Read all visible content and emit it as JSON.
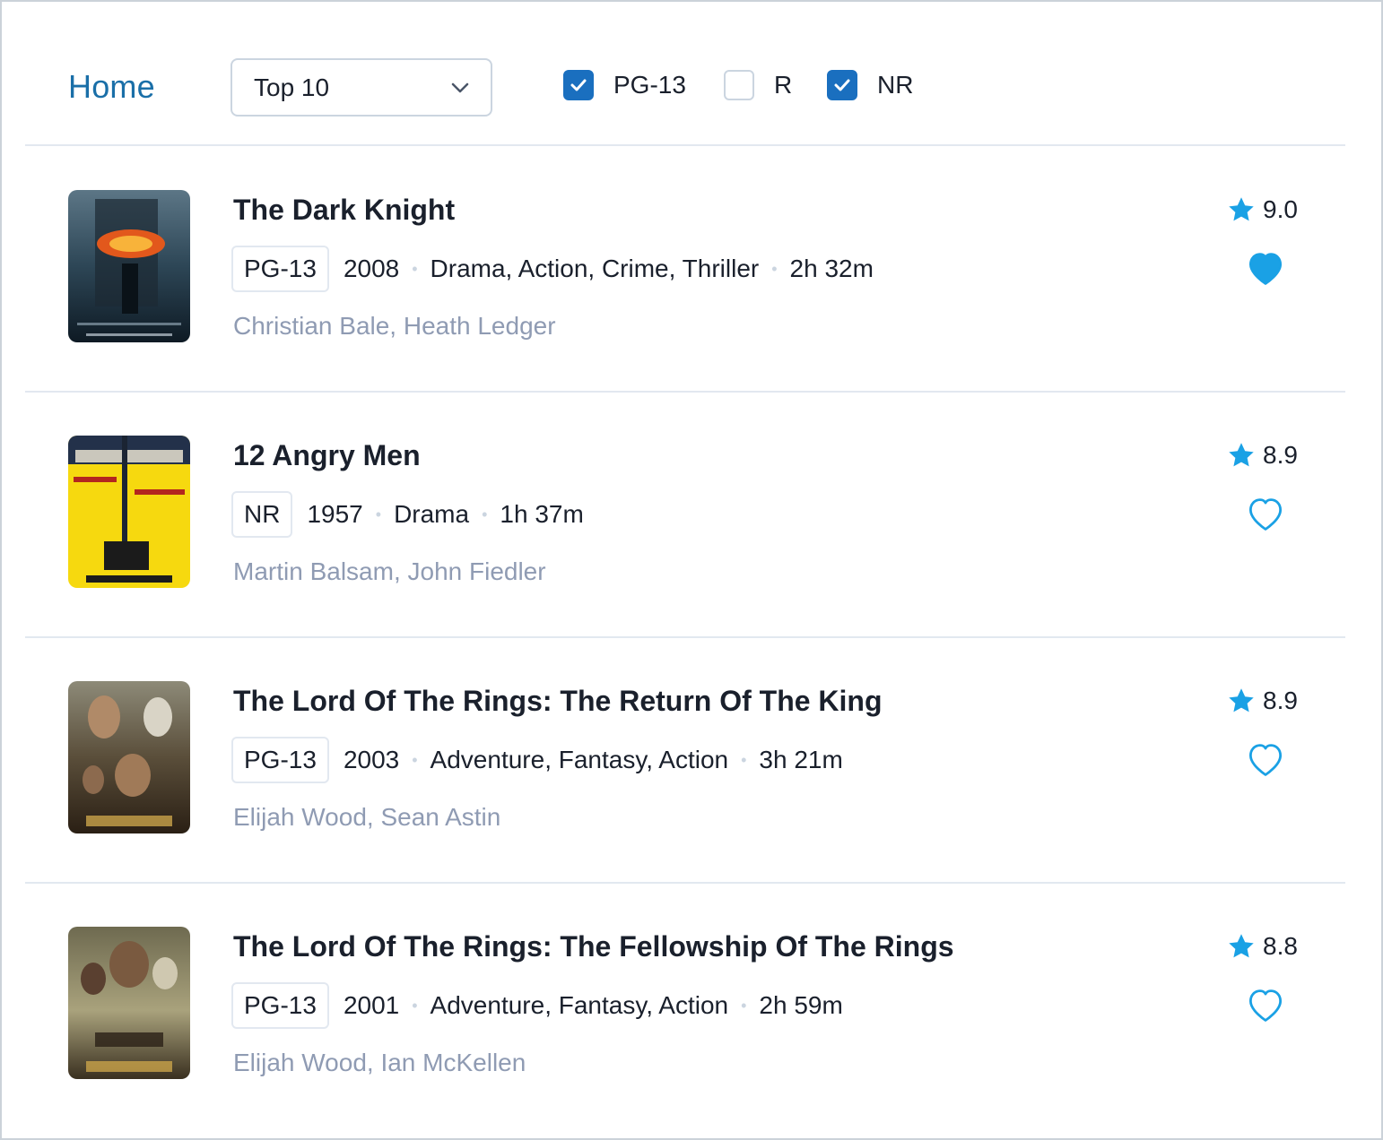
{
  "header": {
    "home_label": "Home",
    "list_select": {
      "value": "Top 10"
    },
    "filters": [
      {
        "label": "PG-13",
        "checked": true
      },
      {
        "label": "R",
        "checked": false
      },
      {
        "label": "NR",
        "checked": true
      }
    ]
  },
  "colors": {
    "accent": "#1aa1e5",
    "link": "#1a6fa8",
    "checkbox": "#1a6fbf",
    "muted": "#8f9bb3"
  },
  "movies": [
    {
      "title": "The Dark Knight",
      "rating": "PG-13",
      "year": "2008",
      "genres": "Drama, Action, Crime, Thriller",
      "runtime": "2h 32m",
      "cast": "Christian Bale, Heath Ledger",
      "score": "9.0",
      "favorite": true,
      "poster_icon": "dark-knight-poster"
    },
    {
      "title": "12 Angry Men",
      "rating": "NR",
      "year": "1957",
      "genres": "Drama",
      "runtime": "1h 37m",
      "cast": "Martin Balsam, John Fiedler",
      "score": "8.9",
      "favorite": false,
      "poster_icon": "twelve-angry-men-poster"
    },
    {
      "title": "The Lord Of The Rings: The Return Of The King",
      "rating": "PG-13",
      "year": "2003",
      "genres": "Adventure, Fantasy, Action",
      "runtime": "3h 21m",
      "cast": "Elijah Wood, Sean Astin",
      "score": "8.9",
      "favorite": false,
      "poster_icon": "return-of-the-king-poster"
    },
    {
      "title": "The Lord Of The Rings: The Fellowship Of The Rings",
      "rating": "PG-13",
      "year": "2001",
      "genres": "Adventure, Fantasy, Action",
      "runtime": "2h 59m",
      "cast": "Elijah Wood, Ian McKellen",
      "score": "8.8",
      "favorite": false,
      "poster_icon": "fellowship-poster"
    }
  ]
}
